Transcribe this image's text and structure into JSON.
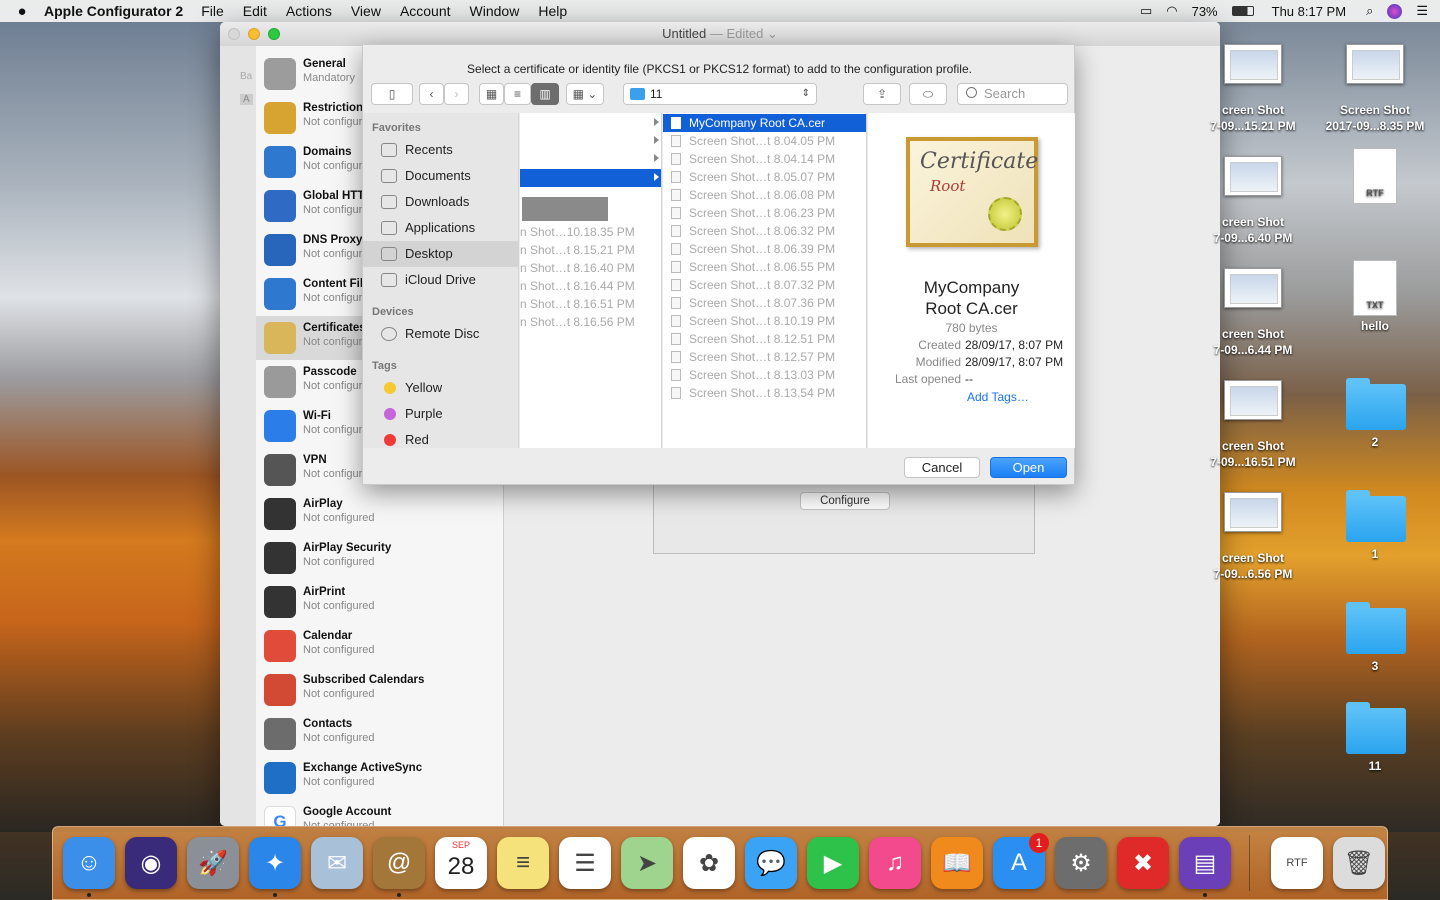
{
  "menubar": {
    "app_name": "Apple Configurator 2",
    "menus": [
      "File",
      "Edit",
      "Actions",
      "View",
      "Account",
      "Window",
      "Help"
    ],
    "battery": "73%",
    "clock": "Thu 8:17 PM"
  },
  "window": {
    "title": "Untitled",
    "title_suffix": "— Edited",
    "partial_left_labels": [
      "Ba",
      "A"
    ]
  },
  "payloads": [
    {
      "name": "General",
      "status": "Mandatory",
      "icon": "general-icon",
      "color": "#9c9c9c"
    },
    {
      "name": "Restrictions",
      "status": "Not configured",
      "icon": "lock-icon",
      "color": "#d8a431"
    },
    {
      "name": "Domains",
      "status": "Not configured",
      "icon": "globe-icon",
      "color": "#2f78d0"
    },
    {
      "name": "Global HTTP Proxy",
      "status": "Not configured",
      "icon": "globe-gear-icon",
      "color": "#2f6ac4"
    },
    {
      "name": "DNS Proxy",
      "status": "Not configured",
      "icon": "globe-wrench-icon",
      "color": "#2766bb"
    },
    {
      "name": "Content Filter",
      "status": "Not configured",
      "icon": "globe-filter-icon",
      "color": "#2f78d0"
    },
    {
      "name": "Certificates",
      "status": "Not configured",
      "icon": "certificate-icon",
      "color": "#d9b65a"
    },
    {
      "name": "Passcode",
      "status": "Not configured",
      "icon": "key-icon",
      "color": "#9a9a9a"
    },
    {
      "name": "Wi-Fi",
      "status": "Not configured",
      "icon": "wifi-icon",
      "color": "#2b7de9"
    },
    {
      "name": "VPN",
      "status": "Not configured",
      "icon": "vpn-icon",
      "color": "#555555"
    },
    {
      "name": "AirPlay",
      "status": "Not configured",
      "icon": "airplay-icon",
      "color": "#333333"
    },
    {
      "name": "AirPlay Security",
      "status": "Not configured",
      "icon": "airplay-security-icon",
      "color": "#333333"
    },
    {
      "name": "AirPrint",
      "status": "Not configured",
      "icon": "printer-icon",
      "color": "#333333"
    },
    {
      "name": "Calendar",
      "status": "Not configured",
      "icon": "calendar-icon",
      "color": "#e04b3a"
    },
    {
      "name": "Subscribed Calendars",
      "status": "Not configured",
      "icon": "subscribed-calendar-icon",
      "color": "#d24a33"
    },
    {
      "name": "Contacts",
      "status": "Not configured",
      "icon": "contacts-icon",
      "color": "#6c6c6c"
    },
    {
      "name": "Exchange ActiveSync",
      "status": "Not configured",
      "icon": "exchange-icon",
      "color": "#1f6fc7"
    },
    {
      "name": "Google Account",
      "status": "Not configured",
      "icon": "google-icon",
      "color": "#ffffff"
    }
  ],
  "content": {
    "configure_button": "Configure"
  },
  "sheet": {
    "message": "Select a certificate or identity file (PKCS1 or PKCS12 format) to add to the configuration profile.",
    "path_folder": "11",
    "search_placeholder": "Search",
    "sidebar": {
      "favorites_heading": "Favorites",
      "favorites": [
        {
          "label": "Recents",
          "icon": "recents-icon"
        },
        {
          "label": "Documents",
          "icon": "documents-icon"
        },
        {
          "label": "Downloads",
          "icon": "downloads-icon"
        },
        {
          "label": "Applications",
          "icon": "applications-icon"
        },
        {
          "label": "Desktop",
          "icon": "desktop-icon"
        },
        {
          "label": "iCloud Drive",
          "icon": "icloud-icon"
        }
      ],
      "devices_heading": "Devices",
      "devices": [
        {
          "label": "Remote Disc",
          "icon": "disc-icon"
        }
      ],
      "tags_heading": "Tags",
      "tags": [
        {
          "label": "Yellow",
          "color": "#f5c930"
        },
        {
          "label": "Purple",
          "color": "#c764d9"
        },
        {
          "label": "Red",
          "color": "#ef3a3a"
        }
      ]
    },
    "column1_files": [
      "n Shot…10.18.35 PM",
      "n Shot…t 8.15.21 PM",
      "n Shot…t 8.16.40 PM",
      "n Shot…t 8.16.44 PM",
      "n Shot…t 8.16.51 PM",
      "n Shot…t 8.16.56 PM"
    ],
    "column2_files": [
      "MyCompany Root CA.cer",
      "Screen Shot…t 8.04.05 PM",
      "Screen Shot…t 8.04.14 PM",
      "Screen Shot…t 8.05.07 PM",
      "Screen Shot…t 8.06.08 PM",
      "Screen Shot…t 8.06.23 PM",
      "Screen Shot…t 8.06.32 PM",
      "Screen Shot…t 8.06.39 PM",
      "Screen Shot…t 8.06.55 PM",
      "Screen Shot…t 8.07.32 PM",
      "Screen Shot…t 8.07.36 PM",
      "Screen Shot…t 8.10.19 PM",
      "Screen Shot…t 8.12.51 PM",
      "Screen Shot…t 8.12.57 PM",
      "Screen Shot…t 8.13.03 PM",
      "Screen Shot…t 8.13.54 PM"
    ],
    "preview": {
      "cert_title": "Certificate",
      "cert_subtitle": "Root",
      "name_line1": "MyCompany",
      "name_line2": "Root CA.cer",
      "size": "780 bytes",
      "created_label": "Created",
      "created_value": "28/09/17, 8:07 PM",
      "modified_label": "Modified",
      "modified_value": "28/09/17, 8:07 PM",
      "last_opened_label": "Last opened",
      "last_opened_value": "--",
      "add_tags": "Add Tags…"
    },
    "cancel_label": "Cancel",
    "open_label": "Open"
  },
  "desktop": [
    {
      "label1": "creen Shot",
      "label2": "7-09...15.21 PM",
      "kind": "thumb"
    },
    {
      "label1": "Screen Shot",
      "label2": "2017-09...8.35 PM",
      "kind": "thumb"
    },
    {
      "label1": "creen Shot",
      "label2": "7-09...6.40 PM",
      "kind": "thumb"
    },
    {
      "label1": "",
      "label2": "",
      "kind": "rtf",
      "type_label": "RTF"
    },
    {
      "label1": "creen Shot",
      "label2": "7-09...6.44 PM",
      "kind": "thumb"
    },
    {
      "label1": "hello",
      "label2": "",
      "kind": "txt",
      "type_label": "TXT"
    },
    {
      "label1": "creen Shot",
      "label2": "7-09...16.51 PM",
      "kind": "thumb"
    },
    {
      "label1": "2",
      "label2": "",
      "kind": "folder"
    },
    {
      "label1": "creen Shot",
      "label2": "7-09...6.56 PM",
      "kind": "thumb"
    },
    {
      "label1": "1",
      "label2": "",
      "kind": "folder"
    },
    {
      "label1": "3",
      "label2": "",
      "kind": "folder"
    },
    {
      "label1": "11",
      "label2": "",
      "kind": "folder"
    }
  ],
  "dock": [
    {
      "name": "finder-icon",
      "color": "#3b8fe8",
      "glyph": "☺"
    },
    {
      "name": "siri-icon",
      "color": "#3a2a7a",
      "glyph": "◉"
    },
    {
      "name": "launchpad-icon",
      "color": "#8a8f98",
      "glyph": "🚀"
    },
    {
      "name": "safari-icon",
      "color": "#2a86e8",
      "glyph": "✦"
    },
    {
      "name": "mail-icon",
      "color": "#a8c0d8",
      "glyph": "✉"
    },
    {
      "name": "contacts-app-icon",
      "color": "#a3763a",
      "glyph": "@"
    },
    {
      "name": "calendar-app-icon",
      "color": "#ffffff",
      "glyph": "28",
      "month": "SEP"
    },
    {
      "name": "notes-icon",
      "color": "#f6e27a",
      "glyph": "≡"
    },
    {
      "name": "reminders-icon",
      "color": "#ffffff",
      "glyph": "☰"
    },
    {
      "name": "maps-icon",
      "color": "#9fd48f",
      "glyph": "➤"
    },
    {
      "name": "photos-icon",
      "color": "#ffffff",
      "glyph": "✿"
    },
    {
      "name": "messages-icon",
      "color": "#3aa3f5",
      "glyph": "💬"
    },
    {
      "name": "facetime-icon",
      "color": "#2ec24a",
      "glyph": "▶"
    },
    {
      "name": "itunes-icon",
      "color": "#f24a8c",
      "glyph": "♫"
    },
    {
      "name": "ibooks-icon",
      "color": "#f08a1c",
      "glyph": "📖"
    },
    {
      "name": "app-store-icon",
      "color": "#2b8ef1",
      "glyph": "A",
      "badge": "1"
    },
    {
      "name": "system-preferences-icon",
      "color": "#6d6d6d",
      "glyph": "⚙"
    },
    {
      "name": "crossover-icon",
      "color": "#e02a2a",
      "glyph": "✖"
    },
    {
      "name": "apple-configurator-icon",
      "color": "#6a3fb8",
      "glyph": "▤"
    },
    {
      "name": "rtf-document-icon",
      "color": "#ffffff",
      "glyph": "RTF"
    },
    {
      "name": "trash-icon",
      "color": "#dcdcdc",
      "glyph": "🗑"
    }
  ]
}
